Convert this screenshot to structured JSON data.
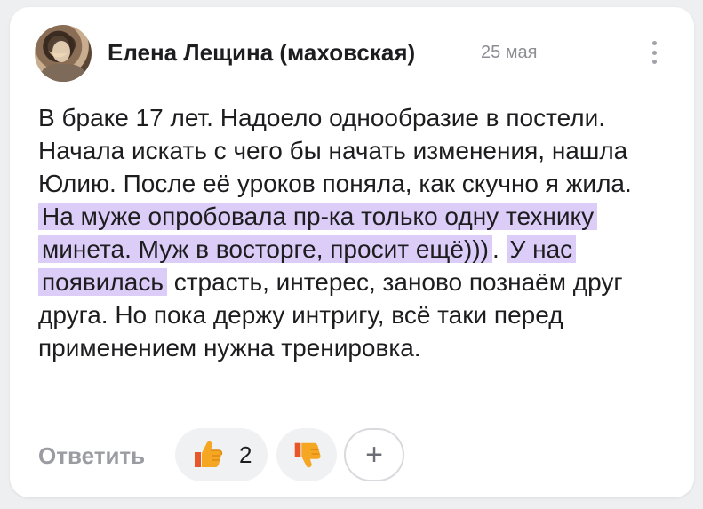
{
  "comment": {
    "author": "Елена Лещина (маховская)",
    "date": "25 мая",
    "text_plain_1": "В браке 17 лет. Надоело однообразие в постели. Начала искать с чего бы начать изменения, нашла Юлию. После её уроков поняла, как скучно я жила. ",
    "text_highlight_1": "На муже опробовала пр-ка только одну технику минета. Муж в восторге, просит ещё)))",
    "text_plain_2": ". ",
    "text_highlight_2": "У нас появилась",
    "text_plain_3": " страсть, интерес, заново познаём друг друга. Но пока держу интригу, всё таки перед применением нужна тренировка."
  },
  "actions": {
    "reply_label": "Ответить",
    "like_count": "2",
    "add_reaction_label": "+"
  },
  "icons": {
    "more": "more-vertical-icon",
    "like": "thumbs-up-icon",
    "dislike": "thumbs-down-icon"
  },
  "colors": {
    "highlight": "#dccdf8",
    "thumb": "#f5a623"
  }
}
